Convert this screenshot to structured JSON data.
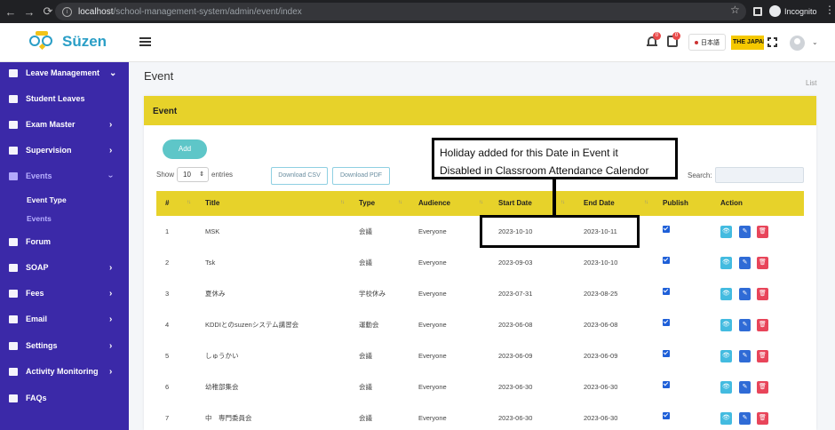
{
  "browser": {
    "url_host": "localhost",
    "url_path": "/school-management-system/admin/event/index",
    "profile_label": "Incognito"
  },
  "header": {
    "logo_text": "Süzen",
    "notification_count": "0",
    "calendar_count": "0",
    "language_label": "日本語",
    "school_label": "THE JAPAN"
  },
  "sidebar": {
    "items": [
      {
        "label": "Leave Management",
        "icon": "leave-icon",
        "chevron": true
      },
      {
        "label": "Student Leaves",
        "icon": "user-icon",
        "chevron": false
      },
      {
        "label": "Exam Master",
        "icon": "exam-icon",
        "chevron": true
      },
      {
        "label": "Supervision",
        "icon": "supervision-icon",
        "chevron": true
      },
      {
        "label": "Events",
        "icon": "calendar-icon",
        "chevron": true
      },
      {
        "label": "Forum",
        "icon": "forum-icon",
        "chevron": false
      },
      {
        "label": "SOAP",
        "icon": "people-icon",
        "chevron": true
      },
      {
        "label": "Fees",
        "icon": "fees-icon",
        "chevron": true
      },
      {
        "label": "Email",
        "icon": "email-icon",
        "chevron": true
      },
      {
        "label": "Settings",
        "icon": "settings-icon",
        "chevron": true
      },
      {
        "label": "Activity Monitoring",
        "icon": "activity-icon",
        "chevron": true
      },
      {
        "label": "FAQs",
        "icon": "faq-icon",
        "chevron": false
      }
    ],
    "sub_items": [
      {
        "label": "Event Type"
      },
      {
        "label": "Events"
      }
    ]
  },
  "page": {
    "title": "Event",
    "breadcrumb": "List",
    "card_title": "Event",
    "add_label": "Add",
    "show_label": "Show",
    "page_size": "10",
    "entries_label": "entries",
    "download_csv_label": "Download CSV",
    "download_pdf_label": "Download PDF",
    "search_label": "Search:"
  },
  "table": {
    "columns": [
      "#",
      "Title",
      "Type",
      "Audience",
      "Start Date",
      "End Date",
      "Publish",
      "Action"
    ],
    "rows": [
      {
        "num": "1",
        "title": "MSK",
        "type": "会議",
        "audience": "Everyone",
        "start": "2023-10-10",
        "end": "2023-10-11",
        "publish": true
      },
      {
        "num": "2",
        "title": "Tsk",
        "type": "会議",
        "audience": "Everyone",
        "start": "2023-09-03",
        "end": "2023-10-10",
        "publish": true
      },
      {
        "num": "3",
        "title": "夏休み",
        "type": "学校休み",
        "audience": "Everyone",
        "start": "2023-07-31",
        "end": "2023-08-25",
        "publish": true
      },
      {
        "num": "4",
        "title": "KDDIとのsuzenシステム講習会",
        "type": "運動会",
        "audience": "Everyone",
        "start": "2023-06-08",
        "end": "2023-06-08",
        "publish": true
      },
      {
        "num": "5",
        "title": "しゅうかい",
        "type": "会議",
        "audience": "Everyone",
        "start": "2023-06-09",
        "end": "2023-06-09",
        "publish": true
      },
      {
        "num": "6",
        "title": "幼稚部集会",
        "type": "会議",
        "audience": "Everyone",
        "start": "2023-06-30",
        "end": "2023-06-30",
        "publish": true
      },
      {
        "num": "7",
        "title": "中　専門委員会",
        "type": "会議",
        "audience": "Everyone",
        "start": "2023-06-30",
        "end": "2023-06-30",
        "publish": true
      }
    ]
  },
  "annotation": {
    "line1": "Holiday added for this Date in Event it",
    "line2": "Disabled in Classroom Attendance Calendor"
  }
}
